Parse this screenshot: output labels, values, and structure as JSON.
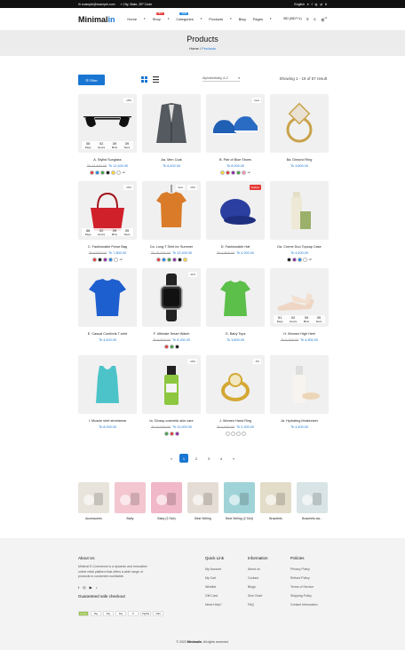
{
  "topbar": {
    "email": "example@example.com",
    "location": "City, State, ZIP Code",
    "language": "English",
    "social": [
      "f",
      "ig",
      "yt",
      "tt"
    ]
  },
  "header": {
    "logo_main": "Minimal",
    "logo_accent": "in",
    "nav": [
      {
        "label": "Home",
        "caret": "▾"
      },
      {
        "label": "Shop",
        "caret": "▾",
        "badge": "HOT",
        "badge_color": "#e53935"
      },
      {
        "label": "Categories",
        "caret": "▾",
        "badge": "NEW",
        "badge_color": "#1e88e5"
      },
      {
        "label": "Products",
        "caret": "▾"
      },
      {
        "label": "Blog"
      },
      {
        "label": "Pages",
        "caret": "▾"
      }
    ],
    "currency": "BD (BDT ৳)",
    "cart_count": "0"
  },
  "banner": {
    "title": "Products",
    "crumb_home": "Home",
    "crumb_sep": "/",
    "crumb_current": "Products"
  },
  "toolbar": {
    "filter_label": "Filter",
    "sort_label": "Alphabetically, A-Z",
    "result_text": "Showing 1 - 16 of 57 result"
  },
  "products": [
    {
      "name": "A. Stylist Sunglass",
      "old": "Tk 14,400.00",
      "new": "Tk 12,400.00",
      "tag": "-18%",
      "colors": [
        "#e53935",
        "#1e88e5",
        "#43a047",
        "#111111",
        "#fdd835",
        "#ffffff"
      ],
      "extra": "+2",
      "countdown": [
        {
          "v": "05",
          "l": "Days"
        },
        {
          "v": "02",
          "l": "Hours"
        },
        {
          "v": "39",
          "l": "Mins"
        },
        {
          "v": "39",
          "l": "Secs"
        }
      ],
      "icon": "sunglasses"
    },
    {
      "name": "Aa. Men Coat",
      "old": "",
      "new": "Tk 6,400.00",
      "tag": "",
      "colors": [],
      "icon": "coat"
    },
    {
      "name": "B. Pair of Blue Shoes",
      "old": "",
      "new": "Tk 8,000.00",
      "tag": "New",
      "colors": [
        "#fdd835",
        "#e53935",
        "#8e24aa",
        "#43a047",
        "#f48fb1"
      ],
      "extra": "+2",
      "icon": "shoes"
    },
    {
      "name": "Ba. Dimond Ring",
      "old": "",
      "new": "Tk 3,800.00",
      "tag": "",
      "colors": [],
      "icon": "ring"
    },
    {
      "name": "C. Fashionable Purse Bag",
      "old": "Tk 8,500.00",
      "new": "Tk 7,800.00",
      "tag": "-16%",
      "colors": [
        "#e53935",
        "#111111",
        "#8e24aa",
        "#1e88e5",
        "#ffffff"
      ],
      "extra": "+2",
      "countdown": [
        {
          "v": "68",
          "l": "Days"
        },
        {
          "v": "02",
          "l": "Hours"
        },
        {
          "v": "39",
          "l": "Mins"
        },
        {
          "v": "39",
          "l": "Secs"
        }
      ],
      "icon": "bag"
    },
    {
      "name": "Ca. Long T Shirt for Summer",
      "old": "Tk 15,000.00",
      "new": "Tk 12,400.00",
      "tag": "-16%",
      "tag2": "New",
      "colors": [
        "#e53935",
        "#1e88e5",
        "#43a047",
        "#8e24aa",
        "#111111",
        "#fdd835"
      ],
      "icon": "tshirt"
    },
    {
      "name": "D. Fashionable Hat",
      "old": "Tk 4,800.00",
      "new": "Tk 4,200.00",
      "tag": "",
      "tag2": "Soldout",
      "colors": [],
      "icon": "hat"
    },
    {
      "name": "Da. Creme Duo Topcap Case",
      "old": "",
      "new": "Tk 4,400.00",
      "tag": "",
      "colors": [
        "#111111",
        "#8e24aa",
        "#1e88e5",
        "#ffffff"
      ],
      "extra": "+2",
      "icon": "bottle"
    },
    {
      "name": "E. Casual Comforts T-shirt",
      "old": "",
      "new": "Tk 4,400.00",
      "tag": "",
      "colors": [],
      "icon": "bluetee"
    },
    {
      "name": "F. Ultimate Smart Watch",
      "old": "Tk 8,500.00",
      "new": "Tk 8,200.00",
      "tag": "-11%",
      "colors": [
        "#e53935",
        "#43a047",
        "#111111"
      ],
      "icon": "watch"
    },
    {
      "name": "G. Baby Tops",
      "old": "",
      "new": "Tk 3,800.00",
      "tag": "",
      "colors": [],
      "icon": "top"
    },
    {
      "name": "H. Women High Heel",
      "old": "Tk 5,200.00",
      "new": "Tk 4,800.00",
      "tag": "",
      "colors": [],
      "countdown": [
        {
          "v": "51",
          "l": "Days"
        },
        {
          "v": "02",
          "l": "Hours"
        },
        {
          "v": "39",
          "l": "Mins"
        },
        {
          "v": "39",
          "l": "Secs"
        }
      ],
      "icon": "heels"
    },
    {
      "name": "I. Muscle shirt streetwear",
      "old": "",
      "new": "Tk 8,000.00",
      "tag": "",
      "colors": [],
      "icon": "tank"
    },
    {
      "name": "Ia. Glossy cosmetic skin care",
      "old": "Tk 12,500.00",
      "new": "Tk 11,000.00",
      "tag": "-16%",
      "colors": [
        "#43a047",
        "#e53935",
        "#8e24aa"
      ],
      "icon": "greenbottle"
    },
    {
      "name": "J. Women Hand Ring",
      "old": "Tk 2,500.00",
      "new": "Tk 2,200.00",
      "tag": "-5%",
      "colors": [
        "#ffffff",
        "#ffffff",
        "#ffffff",
        "#ffffff"
      ],
      "icon": "goldring"
    },
    {
      "name": "Ja. Hydrating Moisturizer",
      "old": "",
      "new": "Tk 4,400.00",
      "tag": "",
      "colors": [],
      "icon": "lotion"
    }
  ],
  "pagination": [
    "«",
    "1",
    "2",
    "3",
    "4",
    "»"
  ],
  "categories": [
    {
      "label": "Accessories",
      "bg": "#e8e4dc"
    },
    {
      "label": "Baby",
      "bg": "#f3c6d0"
    },
    {
      "label": "Baby (2 Slot)",
      "bg": "#f0b8c8"
    },
    {
      "label": "Best Selling",
      "bg": "#e5ddd5"
    },
    {
      "label": "Best Selling (2 Slot)",
      "bg": "#9fd3d8"
    },
    {
      "label": "Bracelets",
      "bg": "#e3dcc9"
    },
    {
      "label": "Bracelets aw...",
      "bg": "#d9e4e6"
    }
  ],
  "footer": {
    "about_title": "About Us",
    "about_text": [
      "Minimal E-Commerce is a dynamic and innovative",
      "online retail platform that offers a wide range of",
      "products to customers worldwide."
    ],
    "guarantee": "Guaranteed safe checkout",
    "payments": [
      "shopify",
      "Pay",
      "Pay",
      "Pay",
      "P",
      "PayPal",
      "VISA"
    ],
    "cols": [
      {
        "title": "Quick Link",
        "items": [
          "My Account",
          "My Cart",
          "Wishlist",
          "Gift Card",
          "Need Help?"
        ]
      },
      {
        "title": "Information",
        "items": [
          "About us",
          "Contact",
          "Blogs",
          "Size Chart",
          "FAQ"
        ]
      },
      {
        "title": "Policies",
        "items": [
          "Privacy Policy",
          "Refund Policy",
          "Terms of Service",
          "Shipping Policy",
          "Contact Information"
        ]
      }
    ],
    "copy_pre": "© 2023 ",
    "copy_brand": "Minimalin",
    "copy_post": ". All rights reserved."
  }
}
